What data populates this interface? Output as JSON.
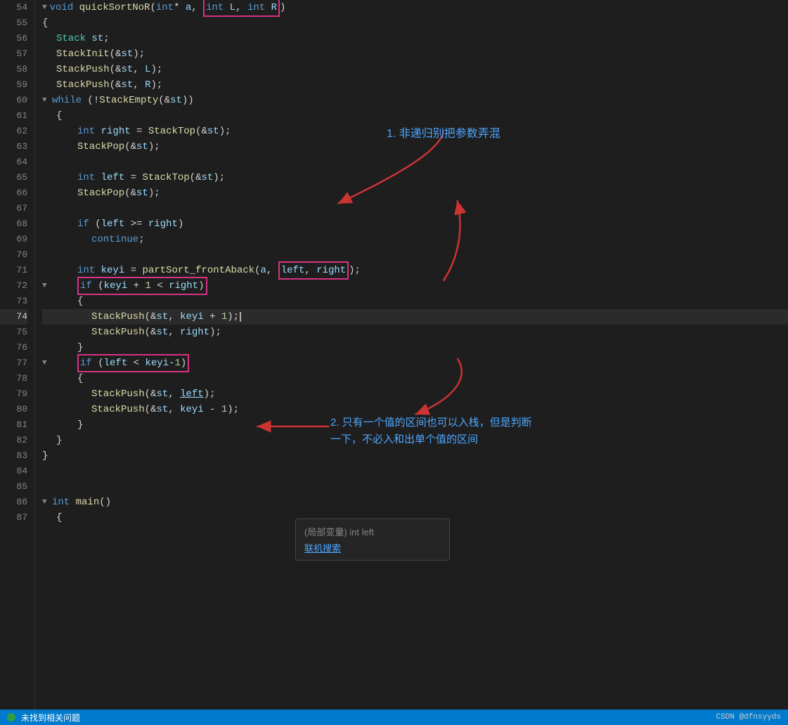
{
  "editor": {
    "background": "#1e1e1e",
    "lines": [
      {
        "num": "54",
        "indent": 0,
        "content": "void quickSortNoR(int* a, int L, int R)",
        "type": "func_def"
      },
      {
        "num": "55",
        "indent": 1,
        "content": "{"
      },
      {
        "num": "56",
        "indent": 2,
        "content": "    Stack st;"
      },
      {
        "num": "57",
        "indent": 2,
        "content": "    StackInit(&st);"
      },
      {
        "num": "58",
        "indent": 2,
        "content": "    StackPush(&st, L);"
      },
      {
        "num": "59",
        "indent": 2,
        "content": "    StackPush(&st, R);"
      },
      {
        "num": "60",
        "indent": 2,
        "content": "    while (!StackEmpty(&st))"
      },
      {
        "num": "61",
        "indent": 3,
        "content": "    {"
      },
      {
        "num": "62",
        "indent": 3,
        "content": "        int right = StackTop(&st);"
      },
      {
        "num": "63",
        "indent": 3,
        "content": "        StackPop(&st);"
      },
      {
        "num": "64",
        "indent": 3,
        "content": ""
      },
      {
        "num": "65",
        "indent": 3,
        "content": "        int left = StackTop(&st);"
      },
      {
        "num": "66",
        "indent": 3,
        "content": "        StackPop(&st);"
      },
      {
        "num": "67",
        "indent": 3,
        "content": ""
      },
      {
        "num": "68",
        "indent": 3,
        "content": "        if (left >= right)"
      },
      {
        "num": "69",
        "indent": 4,
        "content": "            continue;"
      },
      {
        "num": "70",
        "indent": 3,
        "content": ""
      },
      {
        "num": "71",
        "indent": 3,
        "content": "        int keyi = partSort_frontAback(a, left, right);"
      },
      {
        "num": "72",
        "indent": 3,
        "content": "        if (keyi + 1 < right)"
      },
      {
        "num": "73",
        "indent": 4,
        "content": "        {"
      },
      {
        "num": "74",
        "indent": 4,
        "content": "            StackPush(&st, keyi + 1);"
      },
      {
        "num": "75",
        "indent": 4,
        "content": "            StackPush(&st, right);"
      },
      {
        "num": "76",
        "indent": 4,
        "content": "        }"
      },
      {
        "num": "77",
        "indent": 3,
        "content": "        if (left < keyi-1)"
      },
      {
        "num": "78",
        "indent": 4,
        "content": "        {"
      },
      {
        "num": "79",
        "indent": 4,
        "content": "            StackPush(&st, left);"
      },
      {
        "num": "80",
        "indent": 4,
        "content": "            StackPush(&st, keyi - 1);"
      },
      {
        "num": "81",
        "indent": 4,
        "content": "        }"
      },
      {
        "num": "82",
        "indent": 3,
        "content": "    }"
      },
      {
        "num": "83",
        "indent": 2,
        "content": "}"
      },
      {
        "num": "84",
        "indent": 0,
        "content": ""
      },
      {
        "num": "85",
        "indent": 0,
        "content": ""
      },
      {
        "num": "86",
        "indent": 0,
        "content": "int main()"
      },
      {
        "num": "87",
        "indent": 1,
        "content": "    {"
      }
    ],
    "annotations": [
      {
        "id": "box1",
        "text": "int L, int R",
        "label": "param-box-1"
      },
      {
        "id": "box2",
        "text": "left, right",
        "label": "param-box-2"
      },
      {
        "id": "box3",
        "text": "if (keyi + 1 < right)",
        "label": "condition-box-1"
      },
      {
        "id": "box4",
        "text": "if (left < keyi-1)",
        "label": "condition-box-2"
      }
    ],
    "annotation_texts": [
      {
        "id": "anno1",
        "text": "1. 非递归别把参数弄混",
        "position": "top-right"
      },
      {
        "id": "anno2",
        "text": "2. 只有一个值的区间也可以入栈，但是判断",
        "position": "right-middle"
      },
      {
        "id": "anno2b",
        "text": "一下，不必入和出单个值的区间",
        "position": "right-middle-2"
      }
    ]
  },
  "tooltip": {
    "header": "(局部变量) int left",
    "link_text": "联机搜索"
  },
  "status_bar": {
    "error_text": "未找到相关问题",
    "brand_text": "CSDN @dfnsyyds"
  }
}
